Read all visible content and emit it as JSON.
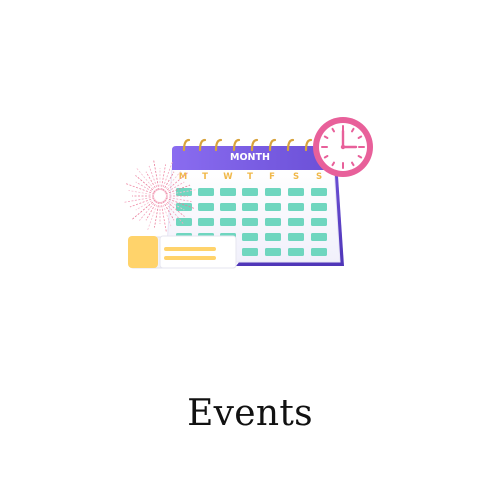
{
  "calendar": {
    "header_label": "MONTH",
    "weekdays": [
      "M",
      "T",
      "W",
      "T",
      "F",
      "S",
      "S"
    ]
  },
  "caption": {
    "text": "Events"
  },
  "colors": {
    "calendar_header": "#7a5ce0",
    "calendar_page": "#ffffff",
    "cell": "#6fd6bf",
    "weekday_text": "#f0b84a",
    "clock_rim": "#e8609a",
    "ticket": "#ffd36b",
    "fireworks": "#f08aa6"
  },
  "icons": {
    "calendar": "calendar-icon",
    "clock": "clock-icon",
    "ticket": "ticket-icon",
    "fireworks": "fireworks-icon"
  }
}
